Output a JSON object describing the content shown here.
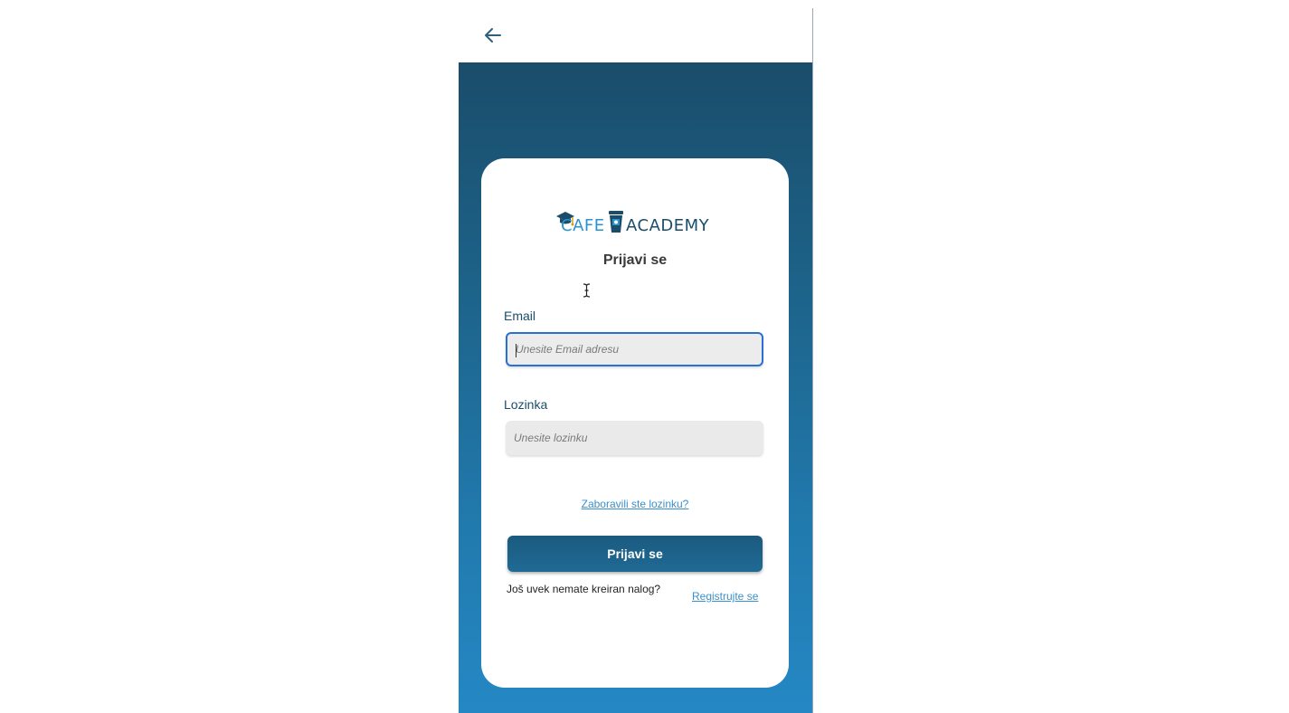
{
  "header": {
    "back_icon": "arrow-left-icon"
  },
  "logo": {
    "text_cafe": "CAFE",
    "text_academy": "ACADEMY"
  },
  "form": {
    "title": "Prijavi se",
    "email": {
      "label": "Email",
      "placeholder": "Unesite Email adresu",
      "value": ""
    },
    "password": {
      "label": "Lozinka",
      "placeholder": "Unesite lozinku",
      "value": ""
    },
    "forgot_password": "Zaboravili ste lozinku?",
    "submit_label": "Prijavi se",
    "no_account_text": "Još uvek nemate kreiran nalog?",
    "register_link": "Registrujte se"
  },
  "colors": {
    "primary_dark": "#1a4d6a",
    "primary_light": "#2588c4",
    "link": "#3a8fcc",
    "focus_border": "#2a6fd6"
  }
}
